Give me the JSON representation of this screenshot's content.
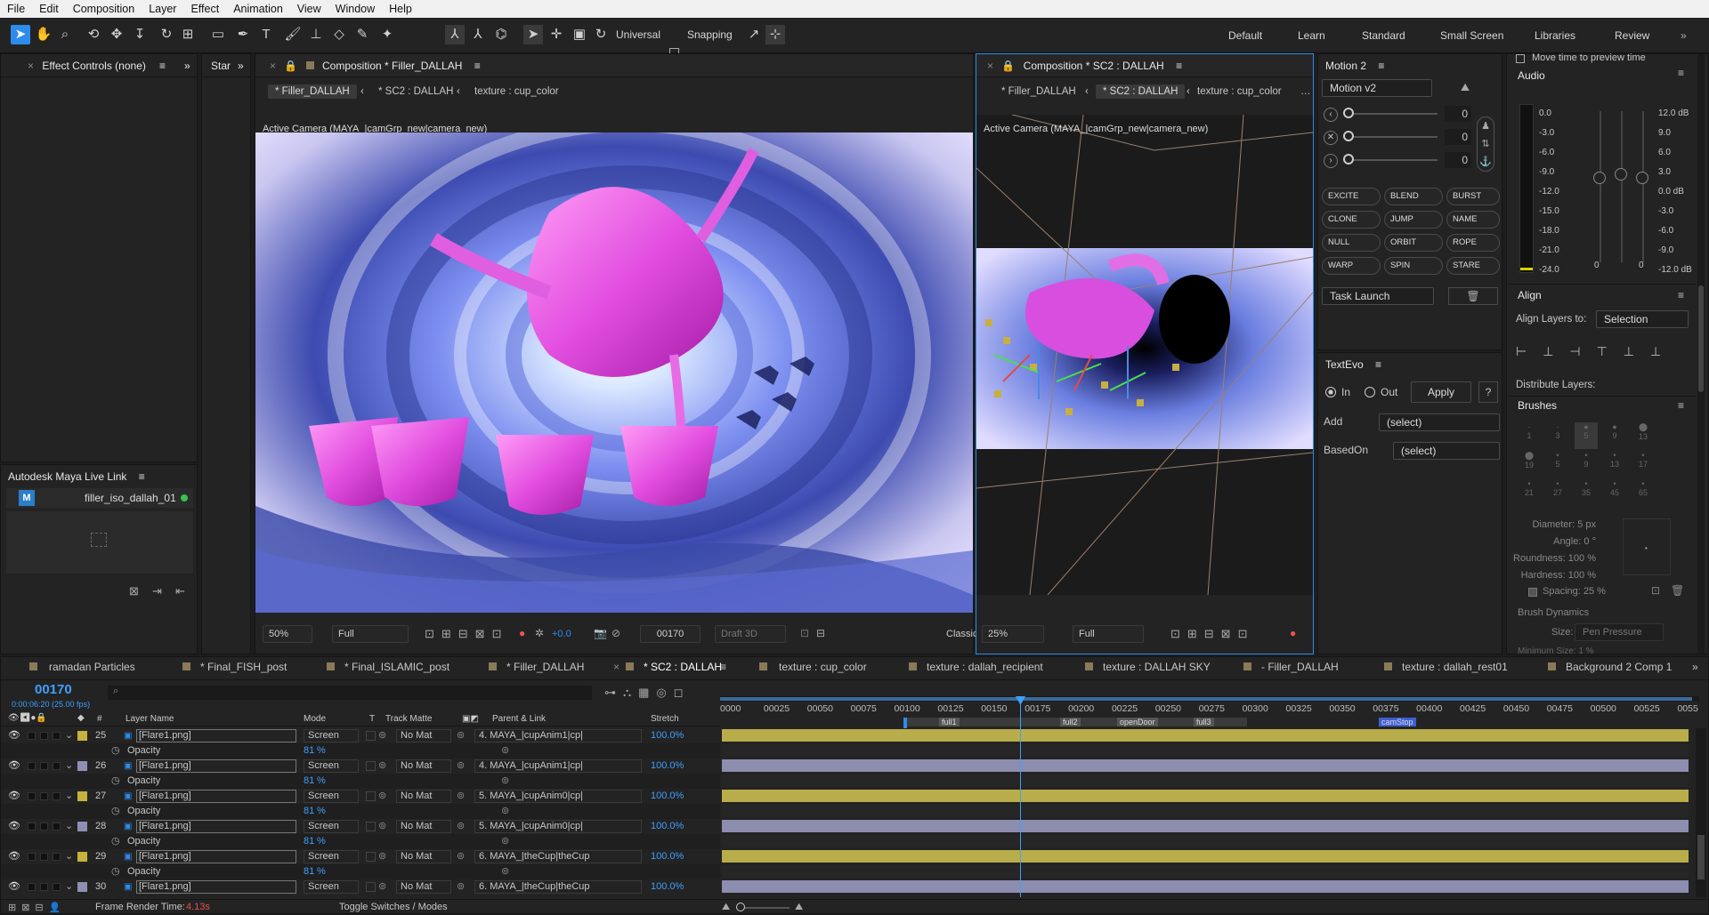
{
  "menu": [
    "File",
    "Edit",
    "Composition",
    "Layer",
    "Effect",
    "Animation",
    "View",
    "Window",
    "Help"
  ],
  "toolbar": {
    "universal_label": "Universal",
    "snapping_label": "Snapping"
  },
  "workspaces": [
    "Default",
    "Learn",
    "Standard",
    "Small Screen",
    "Libraries",
    "Review"
  ],
  "effect_controls": {
    "title": "Effect Controls (none)"
  },
  "start_tab": "Star",
  "maya_panel": {
    "title": "Autodesk Maya Live Link",
    "file": "filler_iso_dallah_01",
    "status_color": "#3cc04a"
  },
  "comp1": {
    "title": "Composition * Filler_DALLAH",
    "crumbs": [
      "* Filler_DALLAH",
      "* SC2 : DALLAH",
      "texture : cup_color"
    ],
    "camera": "Active Camera (MAYA_|camGrp_new|camera_new)",
    "footer": {
      "zoom": "50%",
      "quality": "Full",
      "exposure": "+0.0",
      "frame": "00170",
      "draft": "Draft 3D",
      "renderer": "Classic"
    }
  },
  "comp2": {
    "title": "Composition * SC2 : DALLAH",
    "crumbs": [
      "* Filler_DALLAH",
      "* SC2 : DALLAH",
      "texture : cup_color"
    ],
    "camera": "Active Camera (MAYA_|camGrp_new|camera_new)",
    "footer": {
      "zoom": "25%",
      "quality": "Full"
    }
  },
  "motion": {
    "title": "Motion 2",
    "preset": "Motion v2",
    "sliders": [
      "0",
      "0",
      "0"
    ],
    "buttons": [
      "EXCITE",
      "BLEND",
      "BURST",
      "CLONE",
      "JUMP",
      "NAME",
      "NULL",
      "ORBIT",
      "ROPE",
      "WARP",
      "SPIN",
      "STARE"
    ],
    "task": "Task Launch"
  },
  "textevo": {
    "title": "TextEvo",
    "in": "In",
    "out": "Out",
    "apply": "Apply",
    "help": "?",
    "add_label": "Add",
    "add_value": "(select)",
    "based_label": "BasedOn",
    "based_value": "(select)"
  },
  "right": {
    "move_time": "Move time to preview time",
    "audio_title": "Audio",
    "audio_left": [
      "0.0",
      "-3.0",
      "-6.0",
      "-9.0",
      "-12.0",
      "-15.0",
      "-18.0",
      "-21.0",
      "-24.0"
    ],
    "audio_right": [
      "12.0 dB",
      "9.0",
      "6.0",
      "3.0",
      "0.0 dB",
      "-3.0",
      "-6.0",
      "-9.0",
      "-12.0 dB"
    ],
    "audio_zero": [
      "0",
      "0"
    ],
    "align_title": "Align",
    "align_to_label": "Align Layers to:",
    "align_to_value": "Selection",
    "distribute": "Distribute Layers:",
    "brushes_title": "Brushes",
    "brush_sizes": [
      "1",
      "3",
      "5",
      "9",
      "13",
      "19",
      "5",
      "9",
      "13",
      "17",
      "21",
      "27",
      "35",
      "45",
      "65"
    ],
    "diameter": "Diameter: 5 px",
    "angle": "Angle: 0 °",
    "roundness": "Roundness: 100 %",
    "hardness": "Hardness: 100 %",
    "spacing": "Spacing: 25 %",
    "dynamics": "Brush Dynamics",
    "size_label": "Size:",
    "size_value": "Pen Pressure",
    "min_size": "Minimum Size: 1 %"
  },
  "timeline": {
    "tabs": [
      "ramadan Particles",
      "* Final_FISH_post",
      "* Final_ISLAMIC_post",
      "* Filler_DALLAH",
      "* SC2 : DALLAH",
      "texture : cup_color",
      "texture : dallah_recipient",
      "texture : DALLAH SKY",
      "- Filler_DALLAH",
      "texture : dallah_rest01",
      "Background 2 Comp 1"
    ],
    "time": "00170",
    "time_sub": "0:00:06:20 (25.00 fps)",
    "search_placeholder": "",
    "headers": {
      "num": "#",
      "layer": "Layer Name",
      "mode": "Mode",
      "t": "T",
      "matte": "Track Matte",
      "parent": "Parent & Link",
      "stretch": "Stretch"
    },
    "ruler": [
      "0000",
      "00025",
      "00050",
      "00075",
      "00100",
      "00125",
      "00150",
      "00175",
      "00200",
      "00225",
      "00250",
      "00275",
      "00300",
      "00325",
      "00350",
      "00375",
      "00400",
      "00425",
      "00450",
      "00475",
      "00500",
      "00525",
      "0055"
    ],
    "markers": [
      "full1",
      "full2",
      "openDoor",
      "full3",
      "camStop"
    ],
    "layers": [
      {
        "num": "25",
        "name": "[Flare1.png]",
        "mode": "Screen",
        "matte": "No Mat",
        "parent": "4. MAYA_|cupAnim1|cp|",
        "stretch": "100.0%",
        "color": "#c6b23c",
        "opacity": "81"
      },
      {
        "num": "26",
        "name": "[Flare1.png]",
        "mode": "Screen",
        "matte": "No Mat",
        "parent": "4. MAYA_|cupAnim1|cp|",
        "stretch": "100.0%",
        "color": "#8f8fb4",
        "opacity": "81"
      },
      {
        "num": "27",
        "name": "[Flare1.png]",
        "mode": "Screen",
        "matte": "No Mat",
        "parent": "5. MAYA_|cupAnim0|cp|",
        "stretch": "100.0%",
        "color": "#c6b23c",
        "opacity": "81"
      },
      {
        "num": "28",
        "name": "[Flare1.png]",
        "mode": "Screen",
        "matte": "No Mat",
        "parent": "5. MAYA_|cupAnim0|cp|",
        "stretch": "100.0%",
        "color": "#8f8fb4",
        "opacity": "81"
      },
      {
        "num": "29",
        "name": "[Flare1.png]",
        "mode": "Screen",
        "matte": "No Mat",
        "parent": "6. MAYA_|theCup|theCup",
        "stretch": "100.0%",
        "color": "#c6b23c",
        "opacity": "81"
      },
      {
        "num": "30",
        "name": "[Flare1.png]",
        "mode": "Screen",
        "matte": "No Mat",
        "parent": "6. MAYA_|theCup|theCup",
        "stretch": "100.0%",
        "color": "#8f8fb4",
        "opacity": ""
      }
    ],
    "opacity_label": "Opacity",
    "frame_render_label": "Frame Render Time:",
    "frame_render_value": "4.13s",
    "toggle": "Toggle Switches / Modes"
  },
  "colors": {
    "accent": "#2d8ceb",
    "timecode": "#3ea0ff",
    "layer_yellow": "#b8ad4a",
    "layer_lavender": "#8d8db0"
  }
}
